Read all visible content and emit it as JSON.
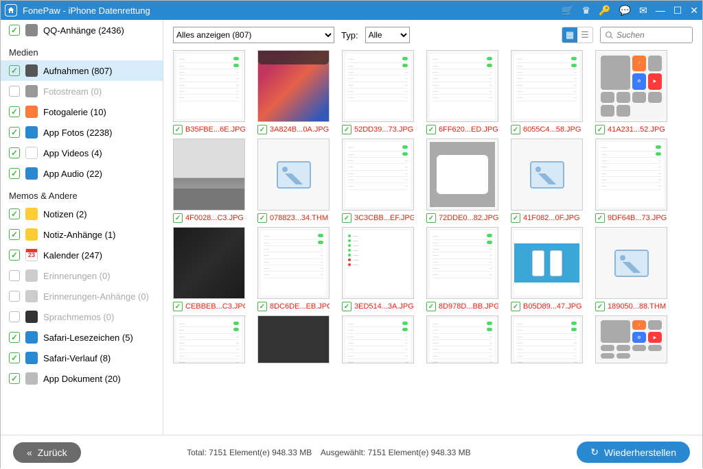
{
  "titlebar": {
    "title": "FonePaw - iPhone Datenrettung"
  },
  "sidebar": {
    "top_item": {
      "label": "QQ-Anhänge (2436)",
      "checked": true
    },
    "groups": [
      {
        "title": "Medien",
        "items": [
          {
            "label": "Aufnahmen (807)",
            "checked": true,
            "selected": true,
            "icon_bg": "#555"
          },
          {
            "label": "Fotostream (0)",
            "checked": false,
            "disabled": true,
            "icon_bg": "#999"
          },
          {
            "label": "Fotogalerie (10)",
            "checked": true,
            "icon_bg": "#ff7b3a"
          },
          {
            "label": "App Fotos (2238)",
            "checked": true,
            "icon_bg": "#2a88d0"
          },
          {
            "label": "App Videos (4)",
            "checked": true,
            "icon_bg": "#fff",
            "icon_border": true
          },
          {
            "label": "App Audio (22)",
            "checked": true,
            "icon_bg": "#2a88d0"
          }
        ]
      },
      {
        "title": "Memos & Andere",
        "items": [
          {
            "label": "Notizen (2)",
            "checked": true,
            "icon_bg": "#ffcc33"
          },
          {
            "label": "Notiz-Anhänge (1)",
            "checked": true,
            "icon_bg": "#ffcc33"
          },
          {
            "label": "Kalender (247)",
            "checked": true,
            "icon_bg": "#fff",
            "icon_text": "23",
            "icon_border": true
          },
          {
            "label": "Erinnerungen (0)",
            "checked": false,
            "disabled": true,
            "icon_bg": "#ccc"
          },
          {
            "label": "Erinnerungen-Anhänge (0)",
            "checked": false,
            "disabled": true,
            "icon_bg": "#ccc"
          },
          {
            "label": "Sprachmemos (0)",
            "checked": false,
            "disabled": true,
            "icon_bg": "#333"
          },
          {
            "label": "Safari-Lesezeichen (5)",
            "checked": true,
            "icon_bg": "#2a88d0"
          },
          {
            "label": "Safari-Verlauf (8)",
            "checked": true,
            "icon_bg": "#2a88d0"
          },
          {
            "label": "App Dokument (20)",
            "checked": true,
            "icon_bg": "#bbb"
          }
        ]
      }
    ]
  },
  "toolbar": {
    "filter_label": "Alles anzeigen (807)",
    "type_label": "Typ:",
    "type_value": "Alle",
    "search_placeholder": "Suchen"
  },
  "files": {
    "row1": [
      {
        "name": "B35FBE...6E.JPG",
        "kind": "settings"
      },
      {
        "name": "3A824B...0A.JPG",
        "kind": "gradient"
      },
      {
        "name": "52DD39...73.JPG",
        "kind": "settings"
      },
      {
        "name": "6FF620...ED.JPG",
        "kind": "settings"
      },
      {
        "name": "6055C4...58.JPG",
        "kind": "settings"
      },
      {
        "name": "41A231...52.JPG",
        "kind": "cc"
      }
    ],
    "row2": [
      {
        "name": "4F0028...C3.JPG",
        "kind": "photo"
      },
      {
        "name": "078823...34.THM",
        "kind": "placeholder"
      },
      {
        "name": "3C3CBB...EF.JPG",
        "kind": "settings"
      },
      {
        "name": "72DDE0...82.JPG",
        "kind": "popup"
      },
      {
        "name": "41F082...0F.JPG",
        "kind": "placeholder"
      },
      {
        "name": "9DF64B...73.JPG",
        "kind": "settings"
      }
    ],
    "row3": [
      {
        "name": "CEBBEB...C3.JPG",
        "kind": "darkgrad"
      },
      {
        "name": "8DC6DE...EB.JPG",
        "kind": "settings"
      },
      {
        "name": "3ED514...3A.JPG",
        "kind": "sidelist"
      },
      {
        "name": "8D978D...BB.JPG",
        "kind": "settings"
      },
      {
        "name": "B05D89...47.JPG",
        "kind": "phones"
      },
      {
        "name": "189050...88.THM",
        "kind": "placeholder"
      }
    ],
    "row4": [
      {
        "name": "",
        "kind": "settings"
      },
      {
        "name": "",
        "kind": "dark"
      },
      {
        "name": "",
        "kind": "settings"
      },
      {
        "name": "",
        "kind": "settings"
      },
      {
        "name": "",
        "kind": "settings"
      },
      {
        "name": "",
        "kind": "cc"
      }
    ]
  },
  "footer": {
    "back": "Zurück",
    "total": "Total: 7151 Element(e) 948.33 MB",
    "selected": "Ausgewählt: 7151 Element(e) 948.33 MB",
    "recover": "Wiederherstellen"
  }
}
